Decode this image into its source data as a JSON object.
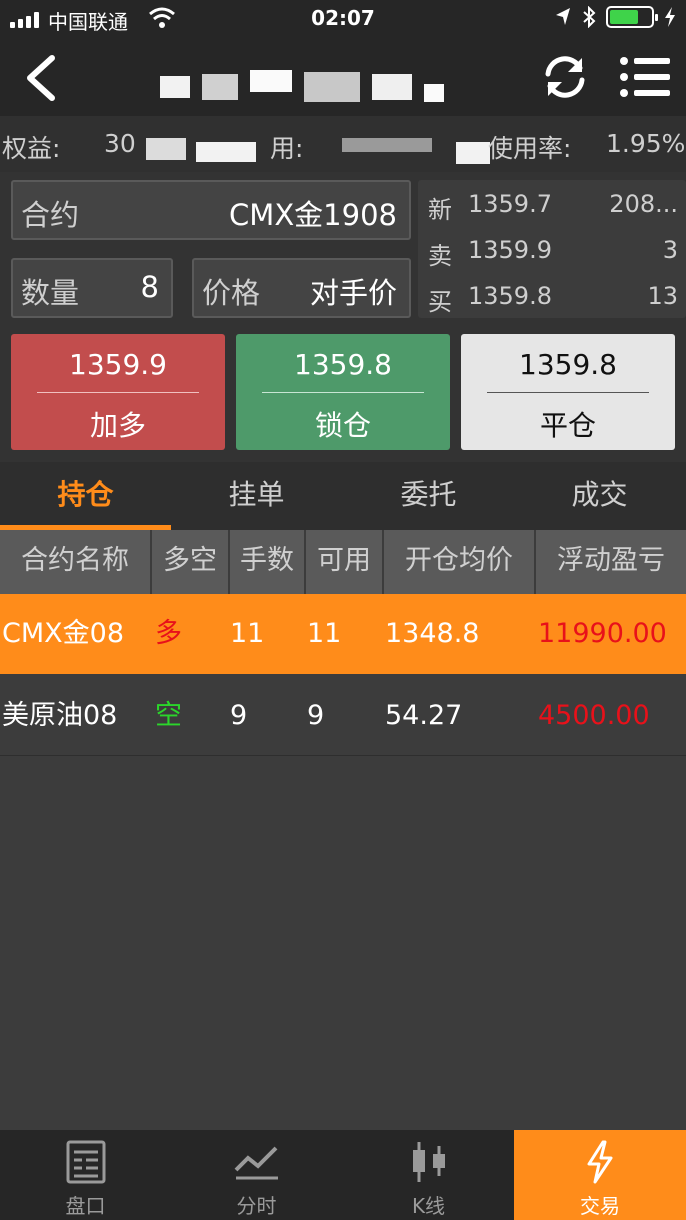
{
  "status": {
    "carrier": "中国联通",
    "time": "02:07"
  },
  "account": {
    "equity_label": "权益:",
    "equity_value": "30",
    "available_label": "用:",
    "usage_label": "使用率:",
    "usage_value": "1.95%"
  },
  "order": {
    "contract_label": "合约",
    "contract_value": "CMX金1908",
    "qty_label": "数量",
    "qty_value": "8",
    "price_label": "价格",
    "price_value": "对手价"
  },
  "quote": [
    {
      "k": "新",
      "price": "1359.7",
      "vol": "208..."
    },
    {
      "k": "卖",
      "price": "1359.9",
      "vol": "3"
    },
    {
      "k": "买",
      "price": "1359.8",
      "vol": "13"
    }
  ],
  "actions": {
    "long": {
      "price": "1359.9",
      "label": "加多"
    },
    "lock": {
      "price": "1359.8",
      "label": "锁仓"
    },
    "close": {
      "price": "1359.8",
      "label": "平仓"
    }
  },
  "tabs": [
    "持仓",
    "挂单",
    "委托",
    "成交"
  ],
  "table": {
    "headers": [
      "合约名称",
      "多空",
      "手数",
      "可用",
      "开仓均价",
      "浮动盈亏"
    ],
    "rows": [
      {
        "name": "CMX金08",
        "dir": "多",
        "lots": "11",
        "avail": "11",
        "avg": "1348.8",
        "pnl": "11990.00"
      },
      {
        "name": "美原油08",
        "dir": "空",
        "lots": "9",
        "avail": "9",
        "avg": "54.27",
        "pnl": "4500.00"
      }
    ]
  },
  "bottom_tabs": [
    "盘口",
    "分时",
    "K线",
    "交易"
  ],
  "colors": {
    "accent": "#ff8c1a",
    "long": "#c24d4d",
    "lock": "#4e9a6a",
    "up": "#e8111a",
    "down": "#2bd62b"
  }
}
